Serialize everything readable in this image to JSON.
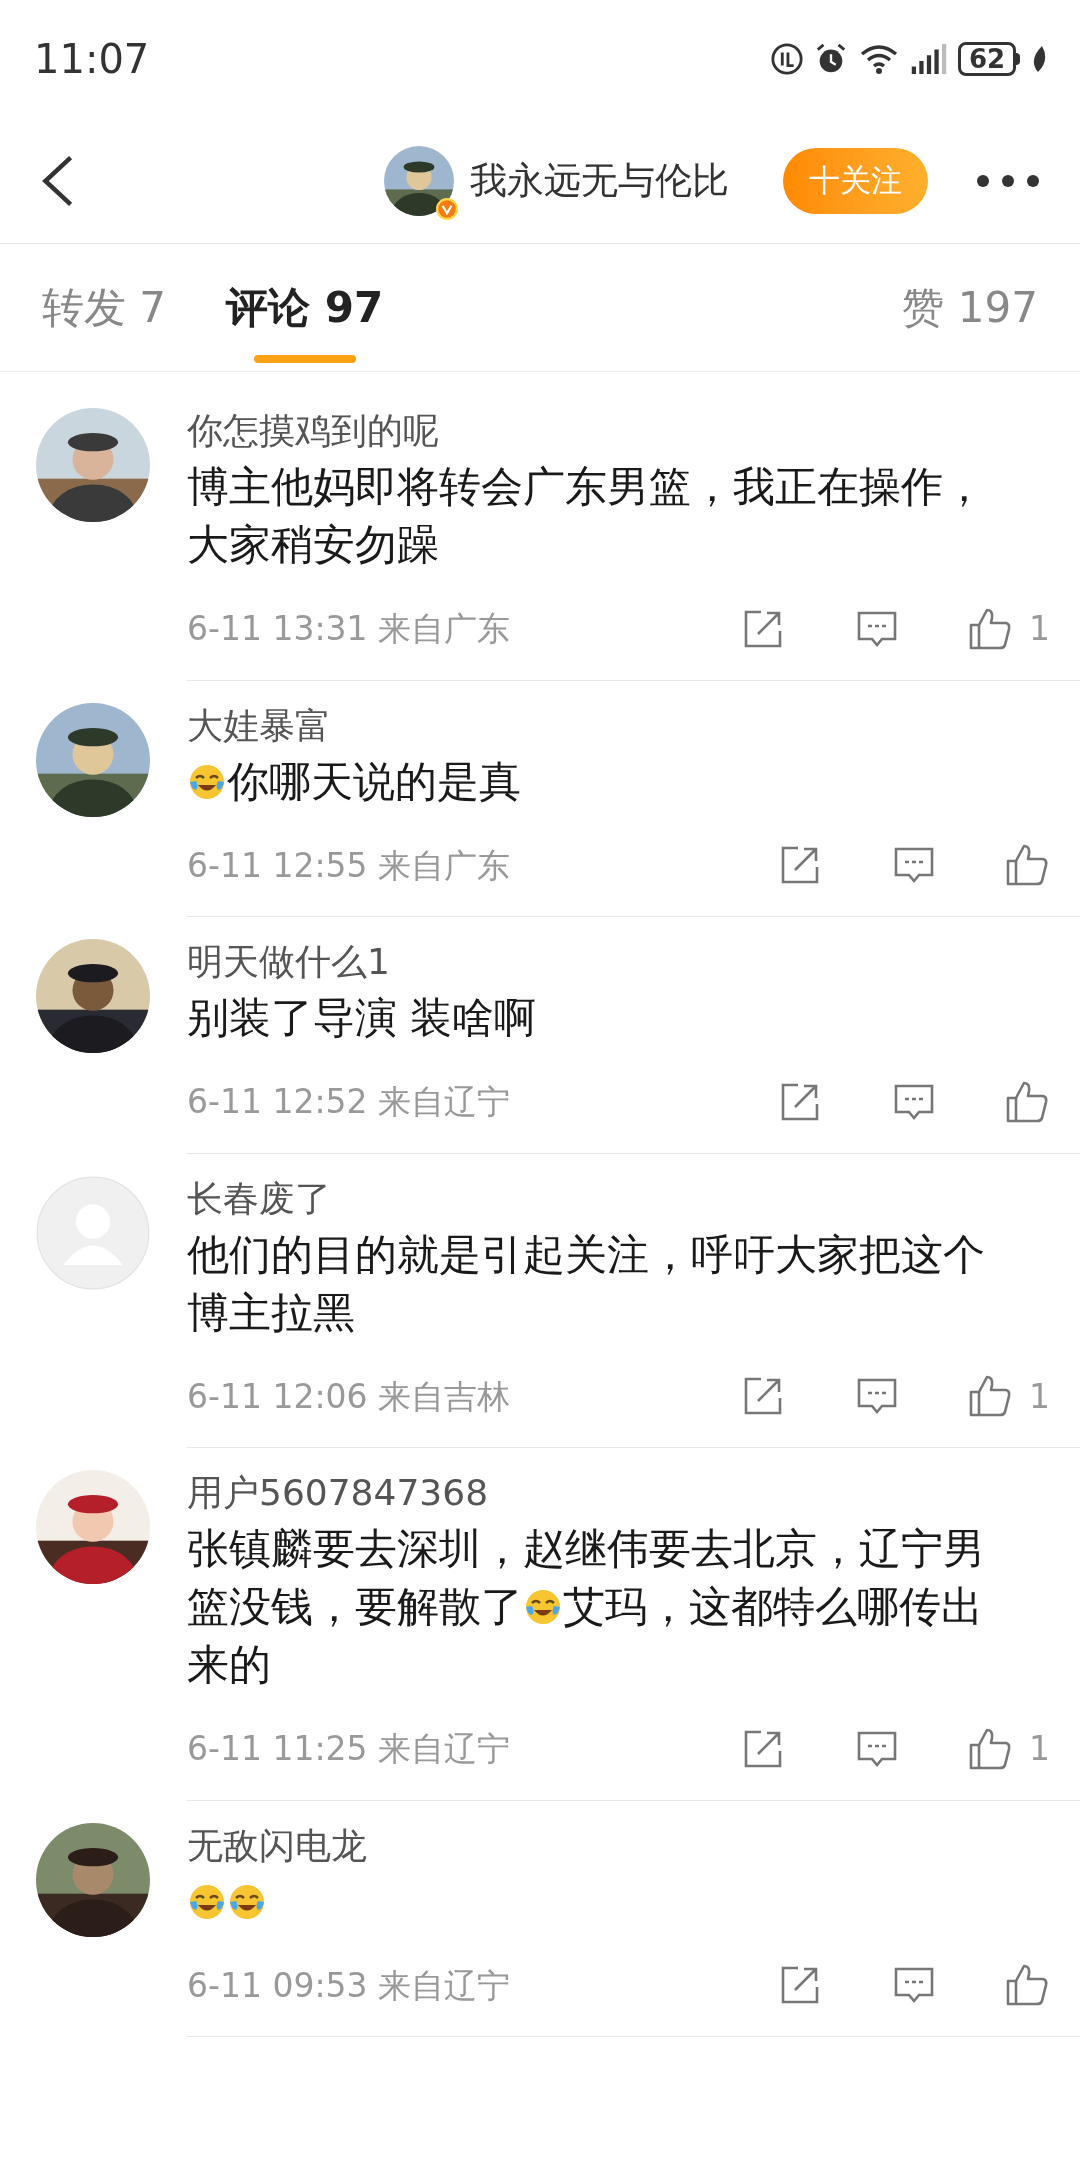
{
  "status_bar": {
    "time": "11:07",
    "battery": "62"
  },
  "header": {
    "user_name": "我永远无与伦比",
    "verified": true,
    "follow_button": "十关注"
  },
  "tabs": [
    {
      "label": "转发 7",
      "selected": false
    },
    {
      "label": "评论 97",
      "selected": true
    },
    {
      "label": "赞 197",
      "selected": false
    }
  ],
  "comments": [
    {
      "avatar": {
        "kind": "picture"
      },
      "name": "你怎摸鸡到的呢",
      "parts": [
        {
          "kind": "text",
          "text": "博主他妈即将转会广东男篮，我正在操作，大家稍安勿躁"
        }
      ],
      "meta": "6-11 13:31 来自广东",
      "likes": "1"
    },
    {
      "avatar": {
        "kind": "picture"
      },
      "name": "大娃暴富",
      "parts": [
        {
          "kind": "emoji"
        },
        {
          "kind": "text",
          "text": "你哪天说的是真"
        }
      ],
      "meta": "6-11 12:55 来自广东"
    },
    {
      "avatar": {
        "kind": "picture"
      },
      "name": "明天做什么1",
      "parts": [
        {
          "kind": "text",
          "text": "别装了导演 装啥啊"
        }
      ],
      "meta": "6-11 12:52 来自辽宁"
    },
    {
      "avatar": {
        "kind": "default"
      },
      "name": "长春废了",
      "parts": [
        {
          "kind": "text",
          "text": "他们的目的就是引起关注，呼吁大家把这个博主拉黑"
        }
      ],
      "meta": "6-11 12:06 来自吉林",
      "likes": "1"
    },
    {
      "avatar": {
        "kind": "picture"
      },
      "name": "用户5607847368",
      "parts": [
        {
          "kind": "text",
          "text": "张镇麟要去深圳，赵继伟要去北京，辽宁男篮没钱，要解散了"
        },
        {
          "kind": "emoji"
        },
        {
          "kind": "text",
          "text": "艾玛，这都特么哪传出来的"
        }
      ],
      "meta": "6-11 11:25 来自辽宁",
      "likes": "1"
    },
    {
      "avatar": {
        "kind": "picture"
      },
      "name": "无敌闪电龙",
      "parts": [
        {
          "kind": "emoji"
        },
        {
          "kind": "emoji"
        }
      ],
      "meta": "6-11 09:53 来自辽宁"
    }
  ]
}
